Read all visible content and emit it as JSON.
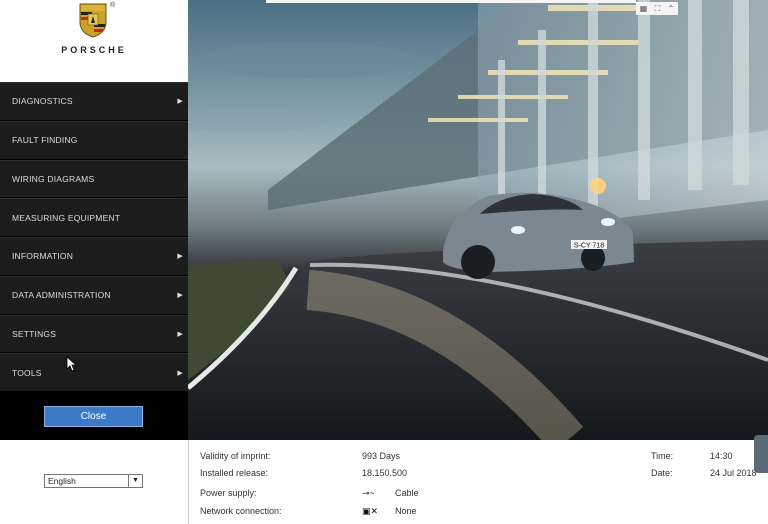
{
  "brand": {
    "wordmark": "PORSCHE",
    "reg_mark": "®"
  },
  "menu": {
    "items": [
      {
        "label": "DIAGNOSTICS",
        "has_submenu": true
      },
      {
        "label": "FAULT FINDING",
        "has_submenu": false
      },
      {
        "label": "WIRING DIAGRAMS",
        "has_submenu": false
      },
      {
        "label": "MEASURING EQUIPMENT",
        "has_submenu": false
      },
      {
        "label": "INFORMATION",
        "has_submenu": true
      },
      {
        "label": "DATA ADMINISTRATION",
        "has_submenu": true
      },
      {
        "label": "SETTINGS",
        "has_submenu": true
      },
      {
        "label": "TOOLS",
        "has_submenu": true
      }
    ],
    "close_label": "Close"
  },
  "hero": {
    "plate": "S-CY 718"
  },
  "language": {
    "selected": "English"
  },
  "status": {
    "validity_label": "Validity of imprint:",
    "validity_value": "993 Days",
    "release_label": "Installed release:",
    "release_value": "18.150.500",
    "power_label": "Power supply:",
    "power_value": "Cable",
    "network_label": "Network connection:",
    "network_value": "None",
    "time_label": "Time:",
    "time_value": "14:30",
    "date_label": "Date:",
    "date_value": "24 Jul 2018"
  },
  "colors": {
    "accent": "#3b7ac6",
    "menu_bg": "#1c1c1c"
  }
}
